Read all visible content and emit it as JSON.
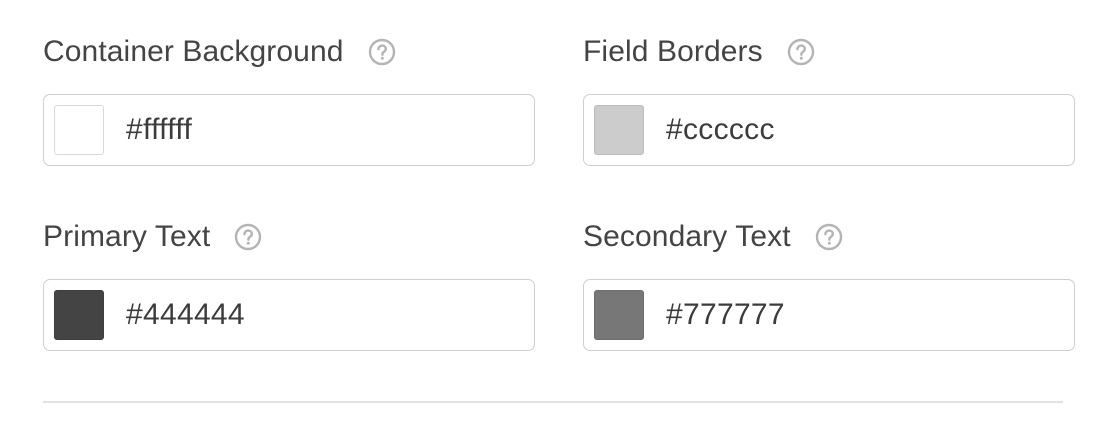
{
  "fields": [
    {
      "label": "Container Background",
      "value": "#ffffff",
      "swatch_color": "#ffffff",
      "help_icon": "question-circle-icon"
    },
    {
      "label": "Field Borders",
      "value": "#cccccc",
      "swatch_color": "#cccccc",
      "help_icon": "question-circle-icon"
    },
    {
      "label": "Primary Text",
      "value": "#444444",
      "swatch_color": "#444444",
      "help_icon": "question-circle-icon"
    },
    {
      "label": "Secondary Text",
      "value": "#777777",
      "swatch_color": "#777777",
      "help_icon": "question-circle-icon"
    }
  ],
  "colors": {
    "label_text": "#444444",
    "input_border": "#cfcfcf",
    "help_icon": "#b4b4b4",
    "divider": "#e2e2e2"
  }
}
